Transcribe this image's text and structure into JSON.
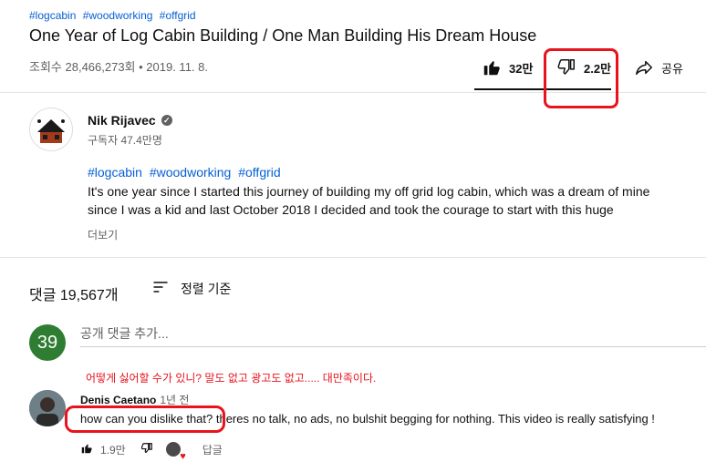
{
  "video": {
    "tags": [
      "#logcabin",
      "#woodworking",
      "#offgrid"
    ],
    "title": "One Year of Log Cabin Building / One Man Building His Dream House",
    "meta": "조회수 28,466,273회 • 2019. 11. 8."
  },
  "actions": {
    "like_count": "32만",
    "dislike_count": "2.2만",
    "share_label": "공유"
  },
  "channel": {
    "name": "Nik Rijavec",
    "subscribers": "구독자 47.4만명"
  },
  "description": {
    "tags": [
      "#logcabin",
      "#woodworking",
      "#offgrid"
    ],
    "text": "It's one year since I started this journey of building my off grid log cabin, which was a dream of mine since I was a kid and last October 2018 I decided and took the courage to start with this huge",
    "more_label": "더보기"
  },
  "comments": {
    "count_label": "댓글 19,567개",
    "sort_label": "정렬 기준",
    "user_avatar_text": "39",
    "add_placeholder": "공개 댓글 추가...",
    "annotation": "어떻게 싫어할 수가 있니? 말도 없고 광고도 없고.....  대만족이다.",
    "items": [
      {
        "author": "Denis Caetano",
        "time": "1년 전",
        "text": "how can you dislike that? theres no talk, no ads, no bulshit begging for nothing. This video is really satisfying !",
        "likes": "1.9만",
        "reply_label": "답글"
      }
    ]
  },
  "colors": {
    "link": "#065fd4",
    "highlight": "#e8131c",
    "user_avatar": "#2e7d32"
  }
}
